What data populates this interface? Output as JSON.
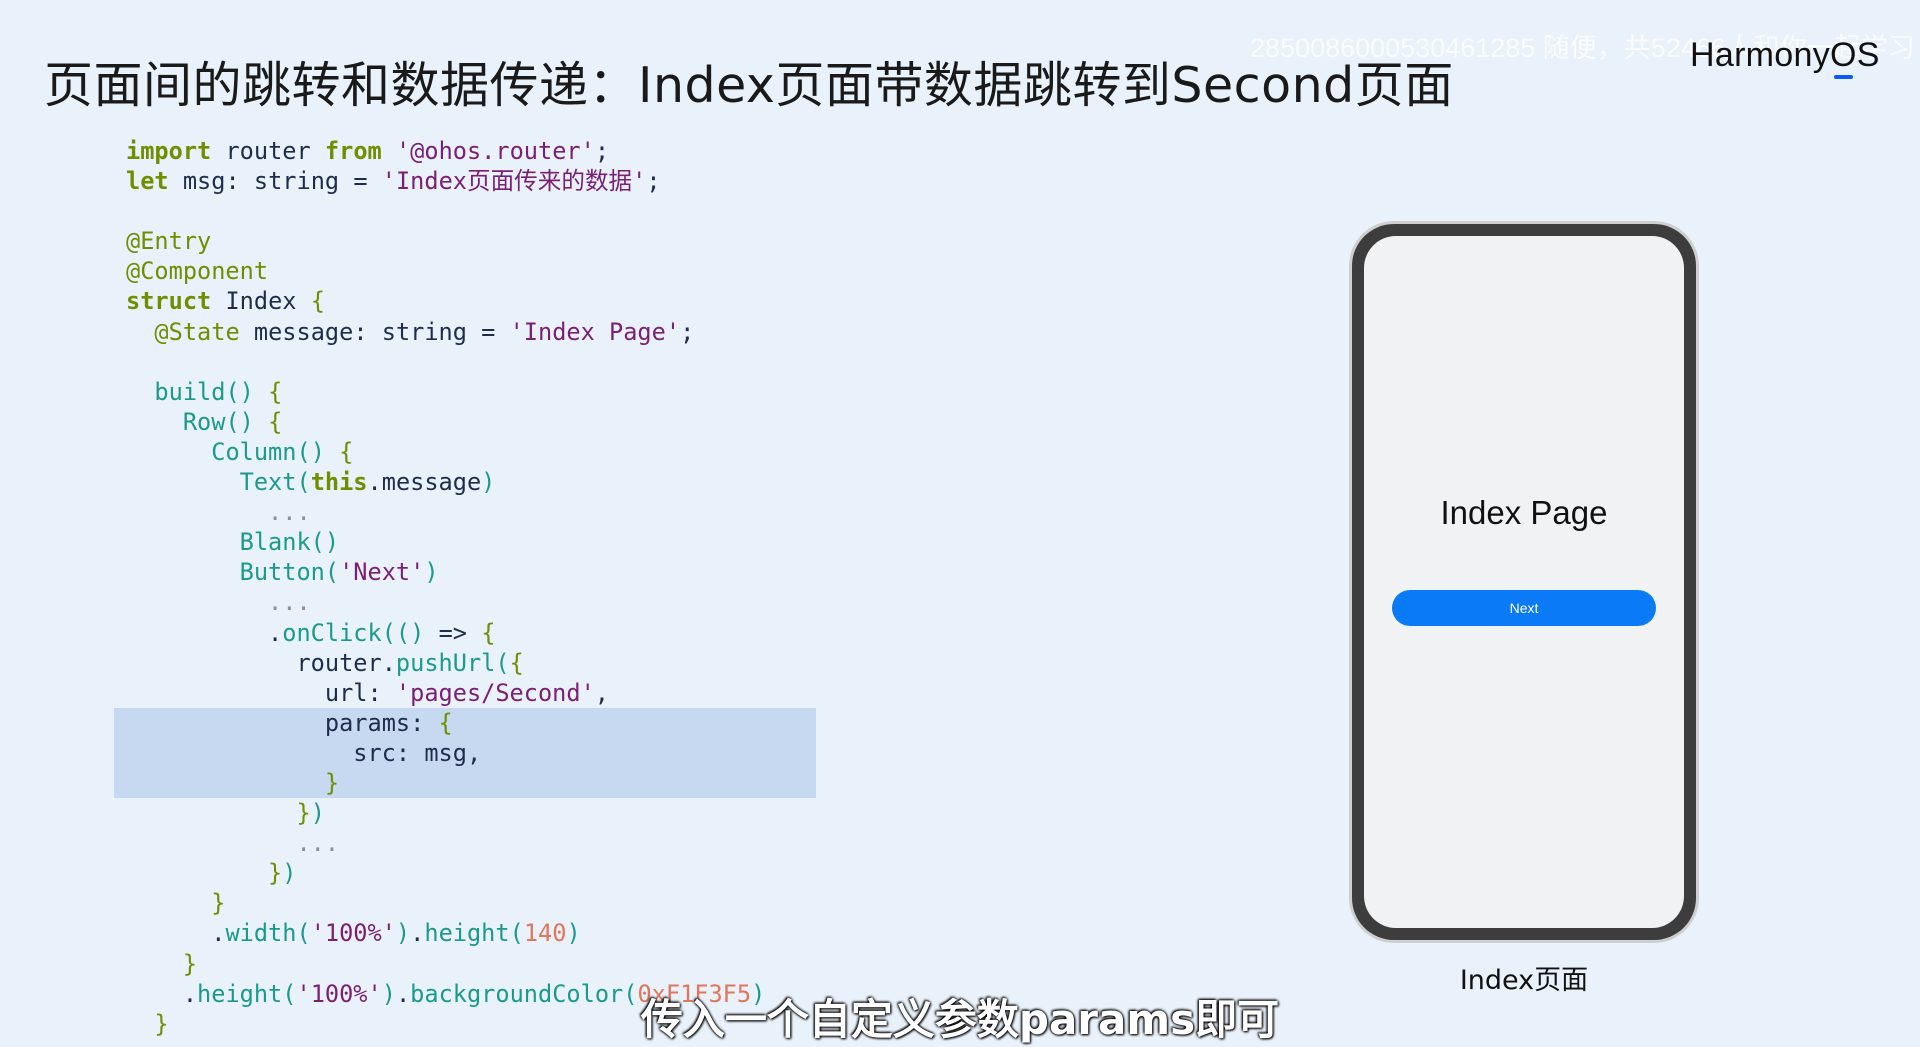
{
  "slide": {
    "title": "页面间的跳转和数据传递：Index页面带数据跳转到Second页面",
    "watermark": "2850086000530461285 随便，共52466人和你一起学习",
    "brand": {
      "prefix": "Harmony",
      "o": "O",
      "suffix": "S",
      "accent_color": "#0a59f7"
    }
  },
  "code": {
    "language": "ArkTS",
    "lines": [
      "import router from '@ohos.router';",
      "let msg: string = 'Index页面传来的数据';",
      "",
      "@Entry",
      "@Component",
      "struct Index {",
      "  @State message: string = 'Index Page';",
      "",
      "  build() {",
      "    Row() {",
      "      Column() {",
      "        Text(this.message)",
      "          ...",
      "        Blank()",
      "        Button('Next')",
      "          ...",
      "          .onClick(() => {",
      "            router.pushUrl({",
      "              url: 'pages/Second',",
      "              params: {",
      "                src: msg,",
      "              }",
      "            })",
      "            ...",
      "          })",
      "      }",
      "      .width('100%').height(140)",
      "    }",
      "    .height('100%').backgroundColor(0xF1F3F5)",
      "  }"
    ],
    "highlighted_lines": [
      19,
      20,
      21
    ],
    "highlight_color": "#c6d9f1"
  },
  "phone": {
    "page_text": "Index Page",
    "button_label": "Next",
    "button_color": "#0a7af7",
    "caption": "Index页面"
  },
  "subtitle": "传入一个自定义参数params即可"
}
